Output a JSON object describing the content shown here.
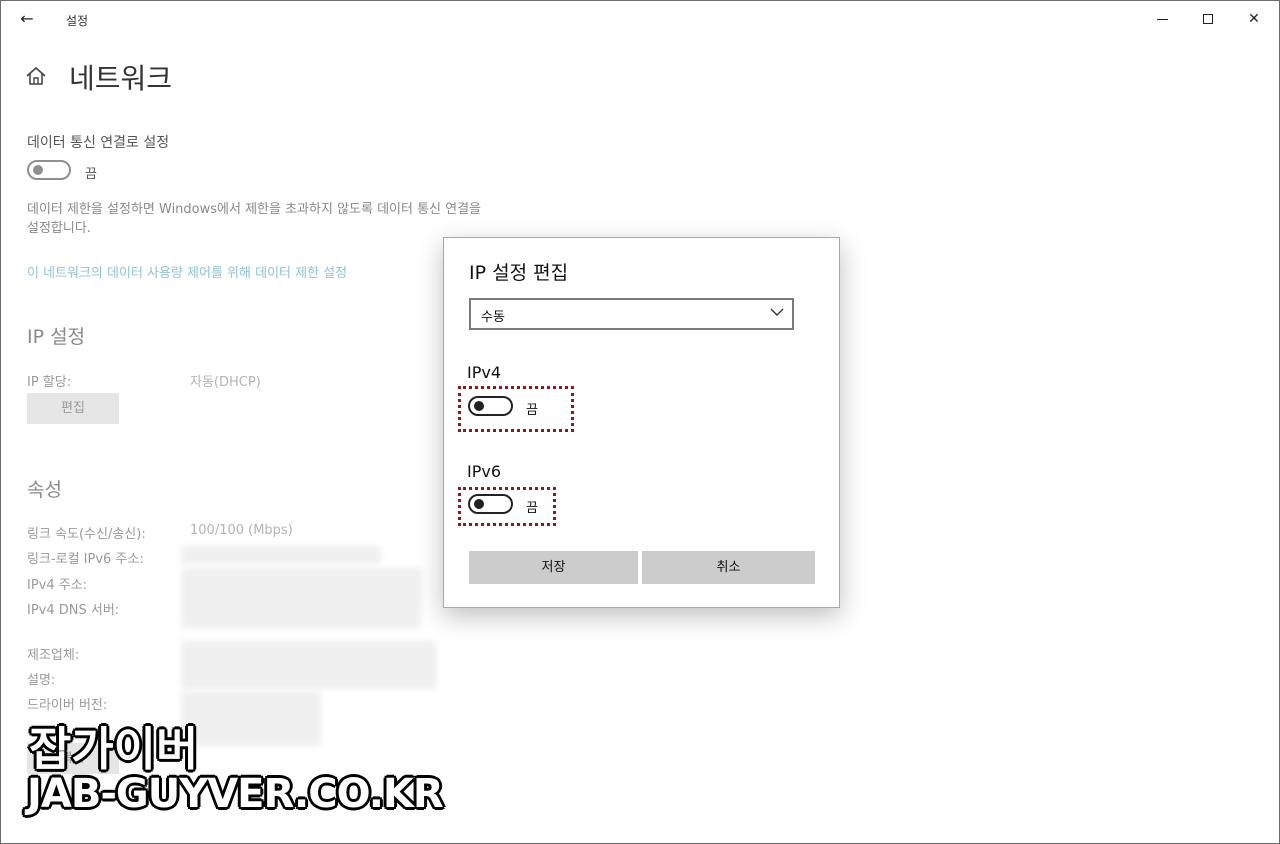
{
  "window": {
    "title": "설정",
    "back_glyph": "←",
    "close_glyph": "✕"
  },
  "page": {
    "title": "네트워크",
    "metered": {
      "heading": "데이터 통신 연결로 설정",
      "toggle_state": "끔",
      "description": "데이터 제한을 설정하면 Windows에서 제한을 초과하지 않도록 데이터 통신 연결을 설정합니다.",
      "link": "이 네트워크의 데이터 사용량 제어를 위해 데이터 제한 설정"
    },
    "ip_settings": {
      "heading": "IP 설정",
      "assign_label": "IP 할당:",
      "assign_value": "자동(DHCP)",
      "edit_button": "편집"
    },
    "properties": {
      "heading": "속성",
      "rows": [
        {
          "label": "링크 속도(수신/송신):",
          "value": "100/100 (Mbps)"
        },
        {
          "label": "링크-로컬 IPv6 주소:",
          "value": ""
        },
        {
          "label": "IPv4 주소:",
          "value": ""
        },
        {
          "label": "IPv4 DNS 서버:",
          "value": ""
        },
        {
          "label": "제조업체:",
          "value": ""
        },
        {
          "label": "설명:",
          "value": ""
        },
        {
          "label": "드라이버 버전:",
          "value": ""
        }
      ],
      "copy_button": "복사"
    }
  },
  "dialog": {
    "title": "IP 설정 편집",
    "mode_select": {
      "value": "수동"
    },
    "ipv4": {
      "label": "IPv4",
      "toggle_state": "끔",
      "on": false
    },
    "ipv6": {
      "label": "IPv6",
      "toggle_state": "끔",
      "on": false
    },
    "save_button": "저장",
    "cancel_button": "취소"
  },
  "watermark": {
    "line1": "잡가이버",
    "line2": "JAB-GUYVER.CO.KR"
  },
  "colors": {
    "link": "#8fc3d6",
    "highlight_border": "#8b1a1a",
    "button_bg": "#cccccc"
  }
}
